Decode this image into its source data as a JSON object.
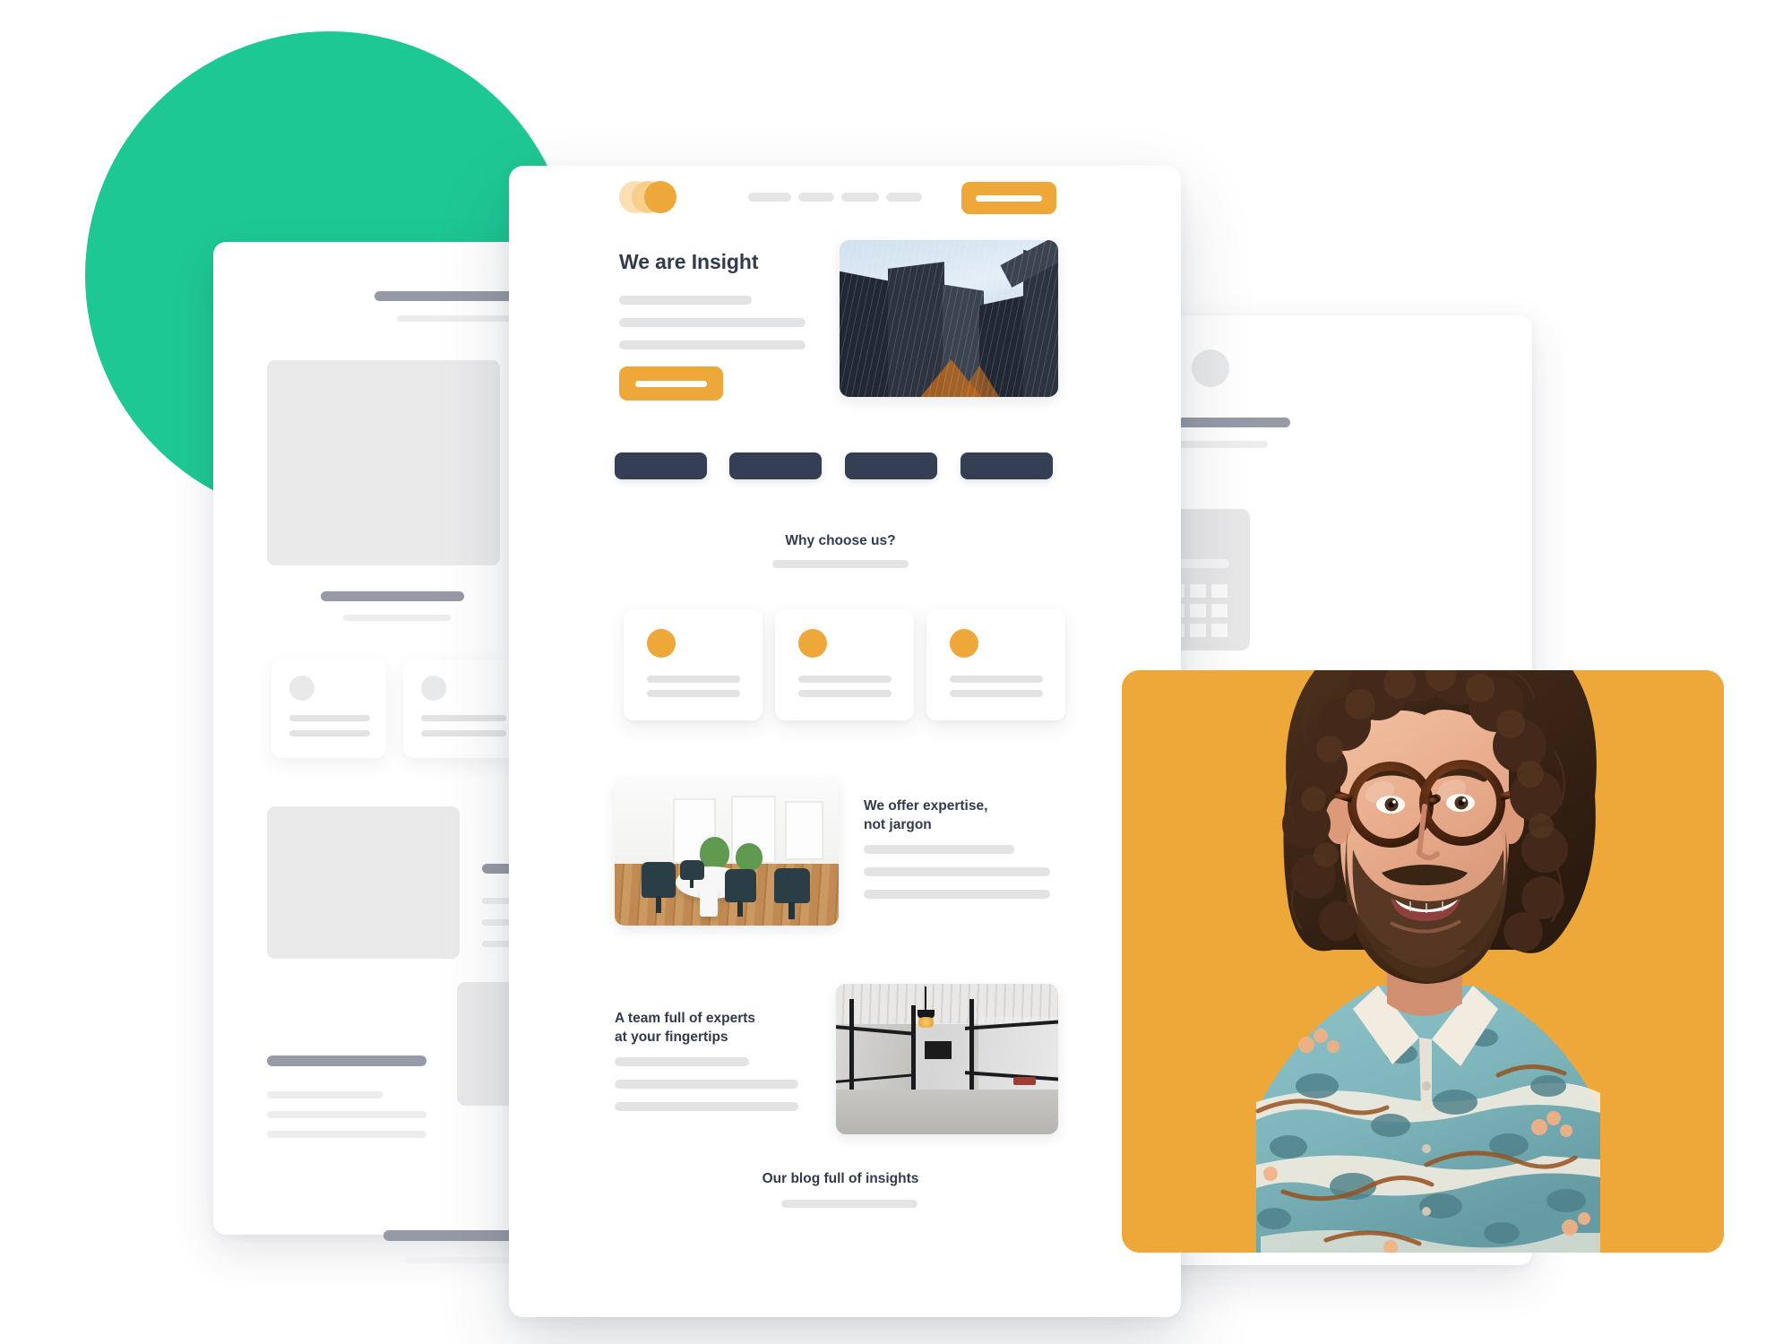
{
  "palette": {
    "green_accent": "#1ec894",
    "orange_accent": "#eda839",
    "navy_dark": "#343f54",
    "heading_text": "#323b4e",
    "skeleton_light": "#e2e3e5",
    "skeleton_dark": "#959aa6",
    "placeholder_block": "#eaeaeb",
    "card_white": "#ffffff",
    "page_background": "#ffffff",
    "shirt_teal": "#7fb9bf",
    "hair_brown": "#4a2f1e"
  },
  "main_mockup": {
    "brand": {
      "logo_name": "three-overlapping-circles-logo",
      "logo_circle_colors": [
        "#f9dfb2",
        "#f6cf8d",
        "#eda839"
      ]
    },
    "nav": {
      "item_count": 4,
      "items": [
        {
          "name": "nav-placeholder-1",
          "label": ""
        },
        {
          "name": "nav-placeholder-2",
          "label": ""
        },
        {
          "name": "nav-placeholder-3",
          "label": ""
        },
        {
          "name": "nav-placeholder-4",
          "label": ""
        }
      ],
      "cta_label": ""
    },
    "hero": {
      "title": "We are Insight",
      "body_line_count": 3,
      "cta_label": "",
      "image_name": "skyscrapers-looking-up-photo"
    },
    "category_pills": {
      "count": 4,
      "color": "#343f54",
      "labels": [
        "",
        "",
        "",
        ""
      ]
    },
    "why_section": {
      "title": "Why choose us?",
      "subtitle_placeholder": "",
      "cards": [
        {
          "name": "feature-card-1",
          "icon": "orange-circle-icon",
          "line_count": 2
        },
        {
          "name": "feature-card-2",
          "icon": "orange-circle-icon",
          "line_count": 2
        },
        {
          "name": "feature-card-3",
          "icon": "orange-circle-icon",
          "line_count": 2
        }
      ]
    },
    "expertise_section": {
      "title": "We offer expertise,\nnot jargon",
      "title_line_1": "We offer expertise,",
      "title_line_2": "not jargon",
      "image_name": "bright-office-meeting-room-photo",
      "image_position": "left",
      "body_line_count": 3
    },
    "team_section": {
      "title_line_1": "A team full of experts",
      "title_line_2": "at your fingertips",
      "image_name": "industrial-corridor-interior-photo",
      "image_position": "right",
      "body_line_count": 3
    },
    "blog_section": {
      "title": "Our blog full of insights",
      "subtitle_placeholder": ""
    }
  },
  "left_mockup": {
    "name": "background-wireframe-card-left",
    "elements": [
      {
        "name": "heading-bar",
        "tone": "dark"
      },
      {
        "name": "subtext-line",
        "tone": "light"
      },
      {
        "name": "large-image-placeholder",
        "tone": "block"
      },
      {
        "name": "heading-bar",
        "tone": "dark"
      },
      {
        "name": "mini-card-pair",
        "tone": "card"
      },
      {
        "name": "image-placeholder",
        "tone": "block"
      },
      {
        "name": "heading-bar",
        "tone": "dark"
      },
      {
        "name": "body-lines",
        "tone": "light"
      },
      {
        "name": "footer-heading-bar",
        "tone": "dark"
      }
    ]
  },
  "right_mockup": {
    "name": "background-wireframe-card-right",
    "elements": [
      {
        "name": "avatar-circle",
        "tone": "circle"
      },
      {
        "name": "heading-bar",
        "tone": "dark"
      },
      {
        "name": "subtext-line",
        "tone": "light"
      },
      {
        "name": "calculator-widget-placeholder",
        "tone": "block"
      }
    ]
  },
  "portrait": {
    "name": "smiling-man-portrait",
    "description": "Smiling bearded man with curly brown hair and round tortoiseshell glasses wearing a teal floral Hawaiian shirt",
    "backdrop_color": "#eda839",
    "backdrop_name": "orange-rounded-card"
  },
  "decoration": {
    "green_circle_name": "green-circle-decoration",
    "green_circle_color": "#1ec894"
  }
}
